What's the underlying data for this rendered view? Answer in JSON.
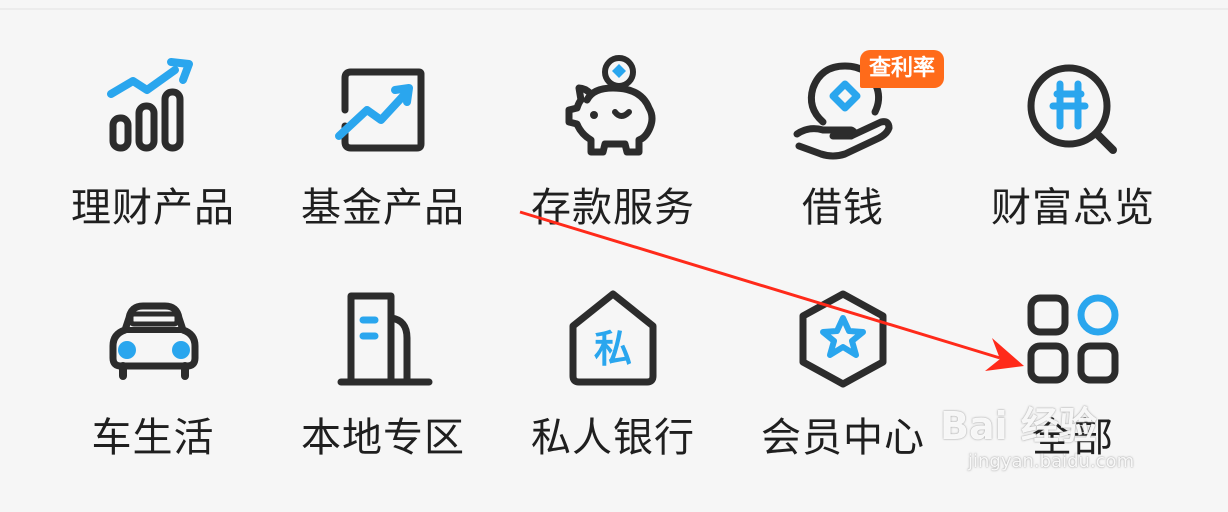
{
  "menu": {
    "items": [
      {
        "label": "理财产品",
        "icon": "wealth-chart-icon"
      },
      {
        "label": "基金产品",
        "icon": "fund-chart-icon"
      },
      {
        "label": "存款服务",
        "icon": "piggy-bank-icon"
      },
      {
        "label": "借钱",
        "icon": "hand-coin-icon",
        "badge": "查利率"
      },
      {
        "label": "财富总览",
        "icon": "yuan-search-icon"
      },
      {
        "label": "车生活",
        "icon": "car-icon"
      },
      {
        "label": "本地专区",
        "icon": "building-icon"
      },
      {
        "label": "私人银行",
        "icon": "private-house-icon"
      },
      {
        "label": "会员中心",
        "icon": "star-hexagon-icon"
      },
      {
        "label": "全部",
        "icon": "all-apps-icon"
      }
    ]
  },
  "watermark": {
    "main": "Bai  经验",
    "sub": "jingyan.baidu.com"
  },
  "colors": {
    "accent_blue": "#2aa6ee",
    "icon_dark": "#2c2c2c",
    "badge": "#ff6b1a",
    "annotation_red": "#ff2a1a"
  }
}
